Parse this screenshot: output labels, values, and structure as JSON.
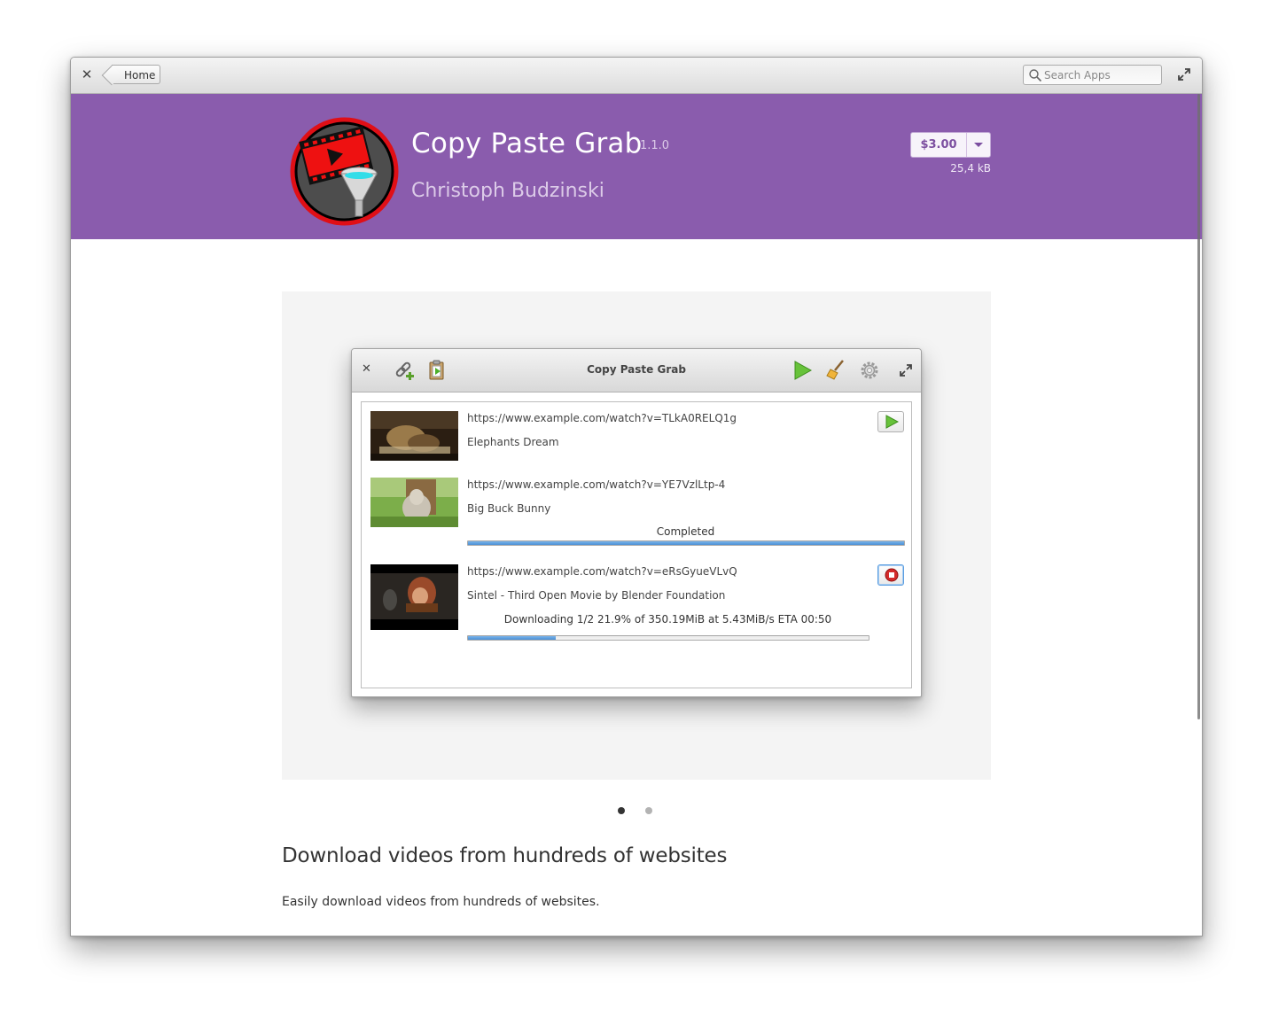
{
  "window": {
    "close_icon": "close-icon",
    "back_label": "Home",
    "search_placeholder": "Search Apps",
    "maximize_icon": "maximize-icon"
  },
  "header": {
    "background": "#8a5cad",
    "app_name": "Copy Paste Grab",
    "version": "1.1.0",
    "author": "Christoph Budzinski",
    "price": "$3.00",
    "size": "25,4 kB"
  },
  "screenshot": {
    "window_title": "Copy Paste Grab",
    "toolbar_icons": [
      "add-link-icon",
      "paste-icon",
      "play-icon",
      "clean-icon",
      "settings-icon",
      "maximize-icon"
    ],
    "downloads": [
      {
        "url": "https://www.example.com/watch?v=TLkA0RELQ1g",
        "title": "Elephants Dream",
        "status": "",
        "action": "play"
      },
      {
        "url": "https://www.example.com/watch?v=YE7VzlLtp-4",
        "title": "Big Buck Bunny",
        "status": "Completed",
        "progress": 1.0
      },
      {
        "url": "https://www.example.com/watch?v=eRsGyueVLvQ",
        "title": "Sintel - Third Open Movie by Blender Foundation",
        "status": "Downloading 1/2   21.9% of 350.19MiB at  5.43MiB/s ETA 00:50",
        "progress": 0.219,
        "action": "stop"
      }
    ]
  },
  "carousel": {
    "pages": 2,
    "active": 1
  },
  "description": {
    "heading": "Download videos from hundreds of websites",
    "text": "Easily download videos from hundreds of websites."
  }
}
